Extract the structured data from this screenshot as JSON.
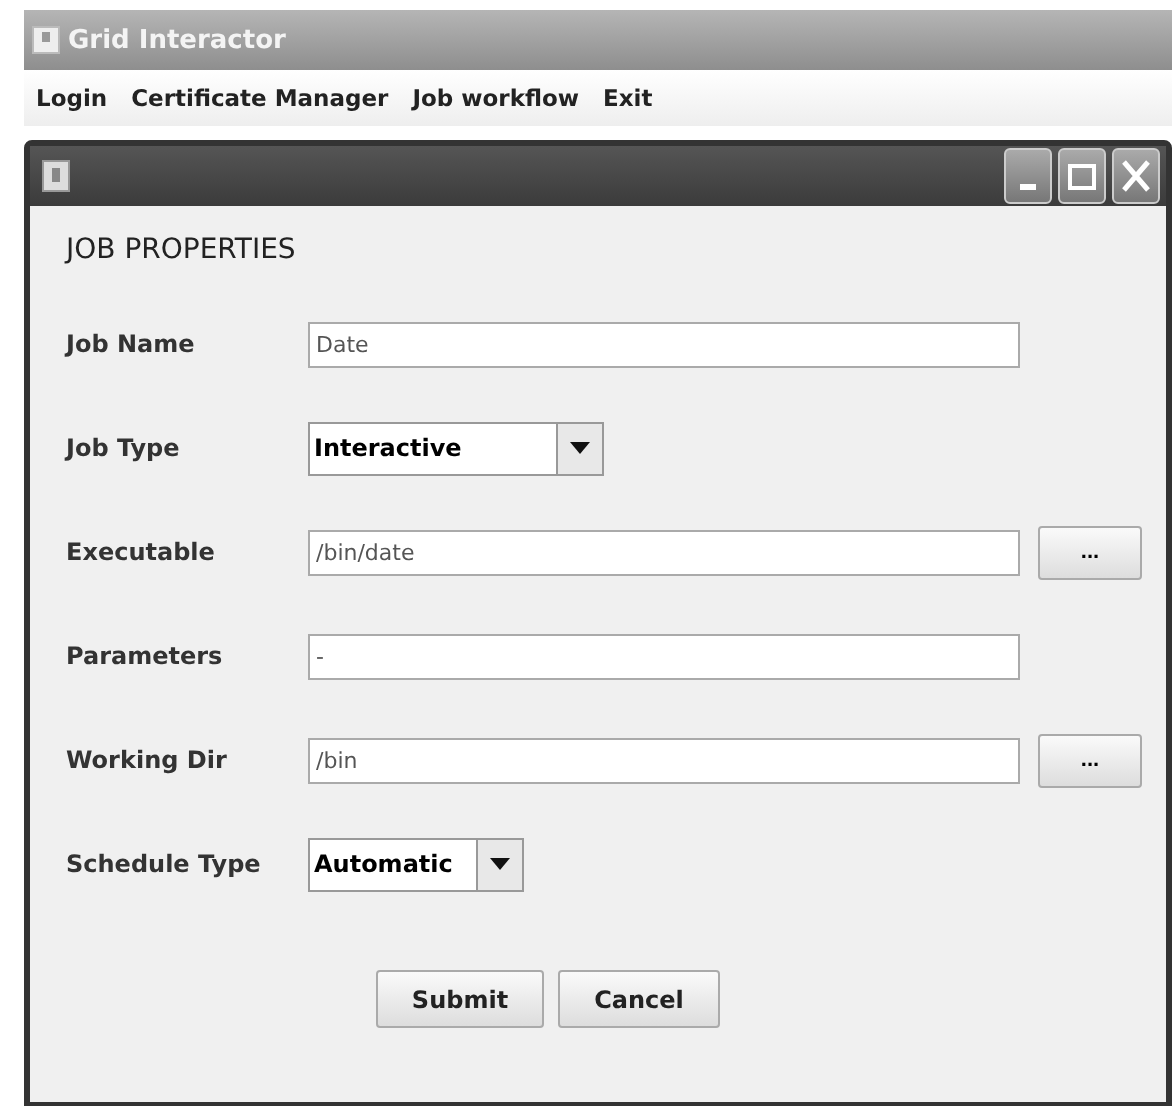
{
  "window": {
    "title": "Grid Interactor"
  },
  "menu": [
    "Login",
    "Certificate Manager",
    "Job workflow",
    "Exit"
  ],
  "dialog": {
    "heading": "JOB PROPERTIES",
    "fields": [
      {
        "label": "Job Name",
        "kind": "text",
        "value": "Date"
      },
      {
        "label": "Job Type",
        "kind": "combo",
        "value": "Interactive"
      },
      {
        "label": "Executable",
        "kind": "text",
        "value": "/bin/date",
        "browse": "..."
      },
      {
        "label": "Parameters",
        "kind": "text",
        "value": "-"
      },
      {
        "label": "Working Dir",
        "kind": "text",
        "value": "/bin",
        "browse": "..."
      },
      {
        "label": "Schedule Type",
        "kind": "combo",
        "value": "Automatic"
      }
    ],
    "buttons": [
      "Submit",
      "Cancel"
    ]
  }
}
